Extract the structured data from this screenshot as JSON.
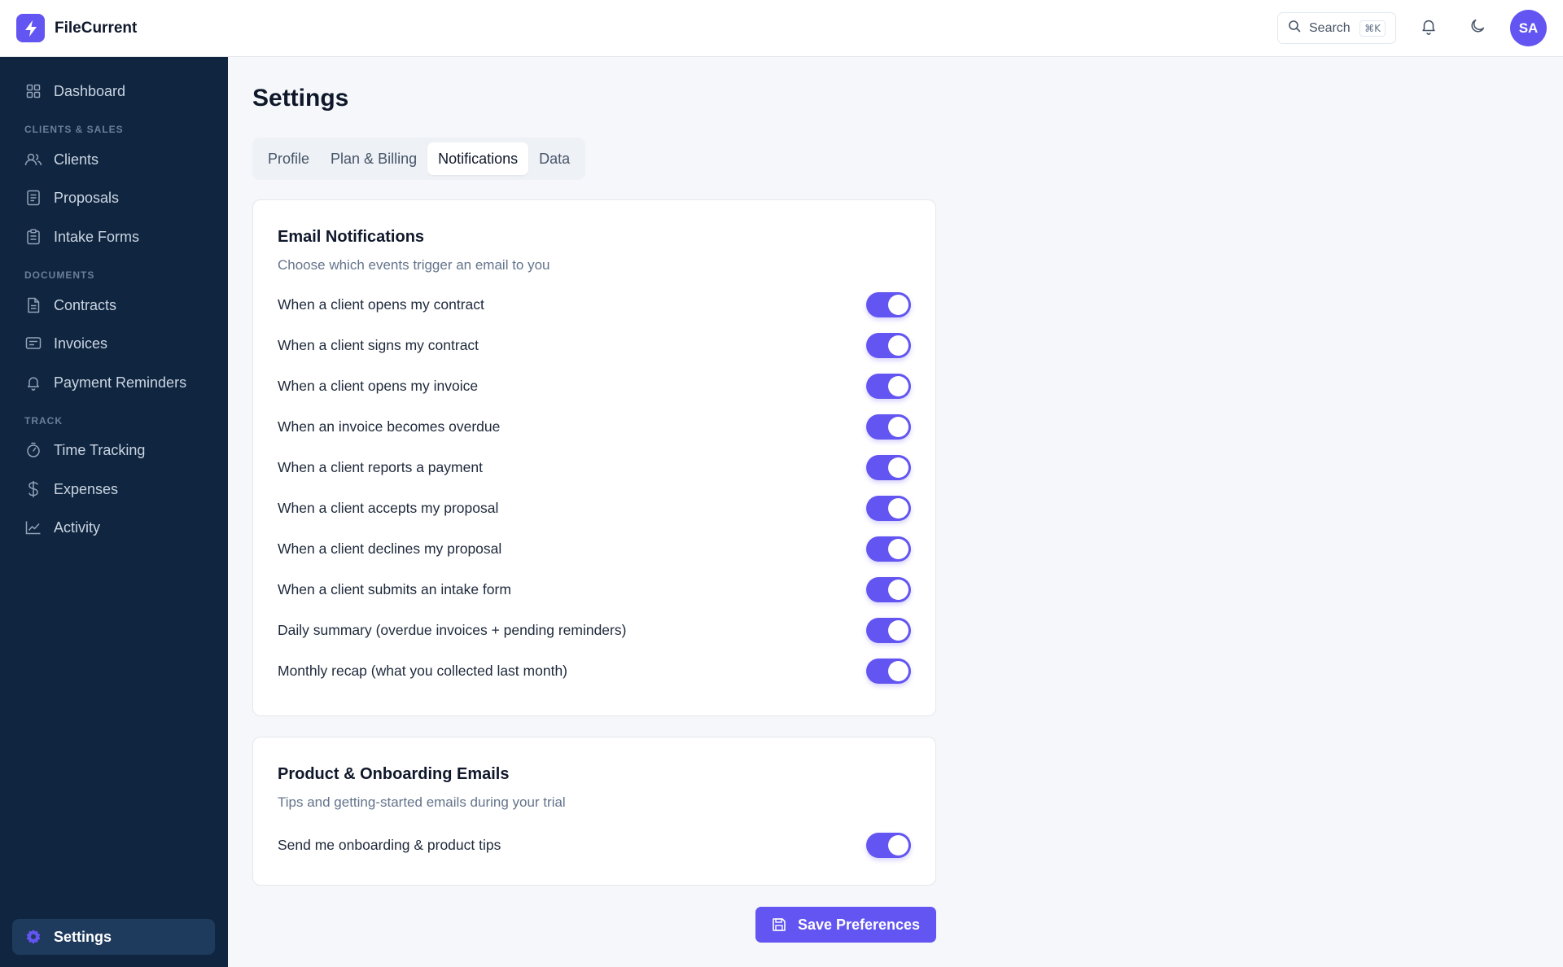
{
  "app": {
    "name": "FileCurrent",
    "accent_color": "#6355f1",
    "sidebar_bg": "#0f2540"
  },
  "topbar": {
    "search_label": "Search",
    "search_shortcut": "⌘K",
    "avatar_initials": "SA",
    "icons": [
      "search-icon",
      "bell-icon",
      "moon-icon"
    ]
  },
  "sidebar": {
    "items": [
      {
        "label": "Dashboard",
        "icon": "grid-icon"
      },
      {
        "section": "CLIENTS & SALES"
      },
      {
        "label": "Clients",
        "icon": "users-icon"
      },
      {
        "label": "Proposals",
        "icon": "document-list-icon"
      },
      {
        "label": "Intake Forms",
        "icon": "clipboard-icon"
      },
      {
        "section": "DOCUMENTS"
      },
      {
        "label": "Contracts",
        "icon": "file-text-icon"
      },
      {
        "label": "Invoices",
        "icon": "receipt-icon"
      },
      {
        "label": "Payment Reminders",
        "icon": "bell-icon"
      },
      {
        "section": "TRACK"
      },
      {
        "label": "Time Tracking",
        "icon": "timer-icon"
      },
      {
        "label": "Expenses",
        "icon": "dollar-icon"
      },
      {
        "label": "Activity",
        "icon": "line-chart-icon"
      }
    ],
    "settings_label": "Settings"
  },
  "page": {
    "title": "Settings",
    "tabs": [
      "Profile",
      "Plan & Billing",
      "Notifications",
      "Data"
    ],
    "active_tab": "Notifications"
  },
  "email_card": {
    "title": "Email Notifications",
    "subtitle": "Choose which events trigger an email to you",
    "rows": [
      {
        "label": "When a client opens my contract",
        "enabled": true
      },
      {
        "label": "When a client signs my contract",
        "enabled": true
      },
      {
        "label": "When a client opens my invoice",
        "enabled": true
      },
      {
        "label": "When an invoice becomes overdue",
        "enabled": true
      },
      {
        "label": "When a client reports a payment",
        "enabled": true
      },
      {
        "label": "When a client accepts my proposal",
        "enabled": true
      },
      {
        "label": "When a client declines my proposal",
        "enabled": true
      },
      {
        "label": "When a client submits an intake form",
        "enabled": true
      },
      {
        "label": "Daily summary (overdue invoices + pending reminders)",
        "enabled": true
      },
      {
        "label": "Monthly recap (what you collected last month)",
        "enabled": true
      }
    ]
  },
  "product_card": {
    "title": "Product & Onboarding Emails",
    "subtitle": "Tips and getting-started emails during your trial",
    "rows": [
      {
        "label": "Send me onboarding & product tips",
        "enabled": true
      }
    ]
  },
  "save_button": {
    "label": "Save Preferences",
    "icon": "save-icon"
  }
}
